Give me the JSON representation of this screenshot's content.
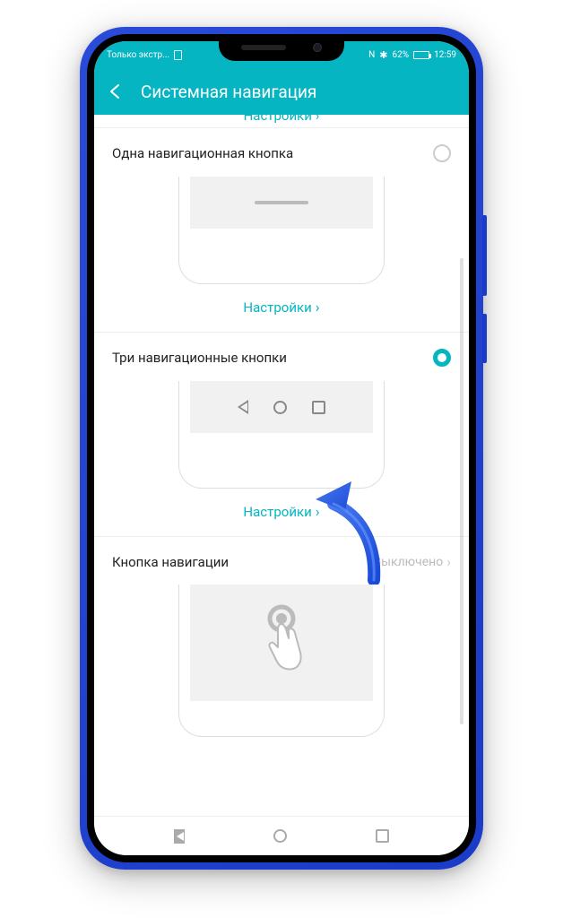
{
  "status": {
    "carrier": "Только экстр...",
    "nfc": "N",
    "bluetooth": "✱",
    "battery_pct": "62%",
    "time": "12:59"
  },
  "header": {
    "title": "Системная навигация"
  },
  "partial_settings": "Настройки",
  "options": [
    {
      "title": "Одна навигационная кнопка",
      "settings": "Настройки",
      "selected": false
    },
    {
      "title": "Три навигационные кнопки",
      "settings": "Настройки",
      "selected": true
    },
    {
      "title": "Кнопка навигации",
      "status": "Выключено",
      "selected": false
    }
  ]
}
